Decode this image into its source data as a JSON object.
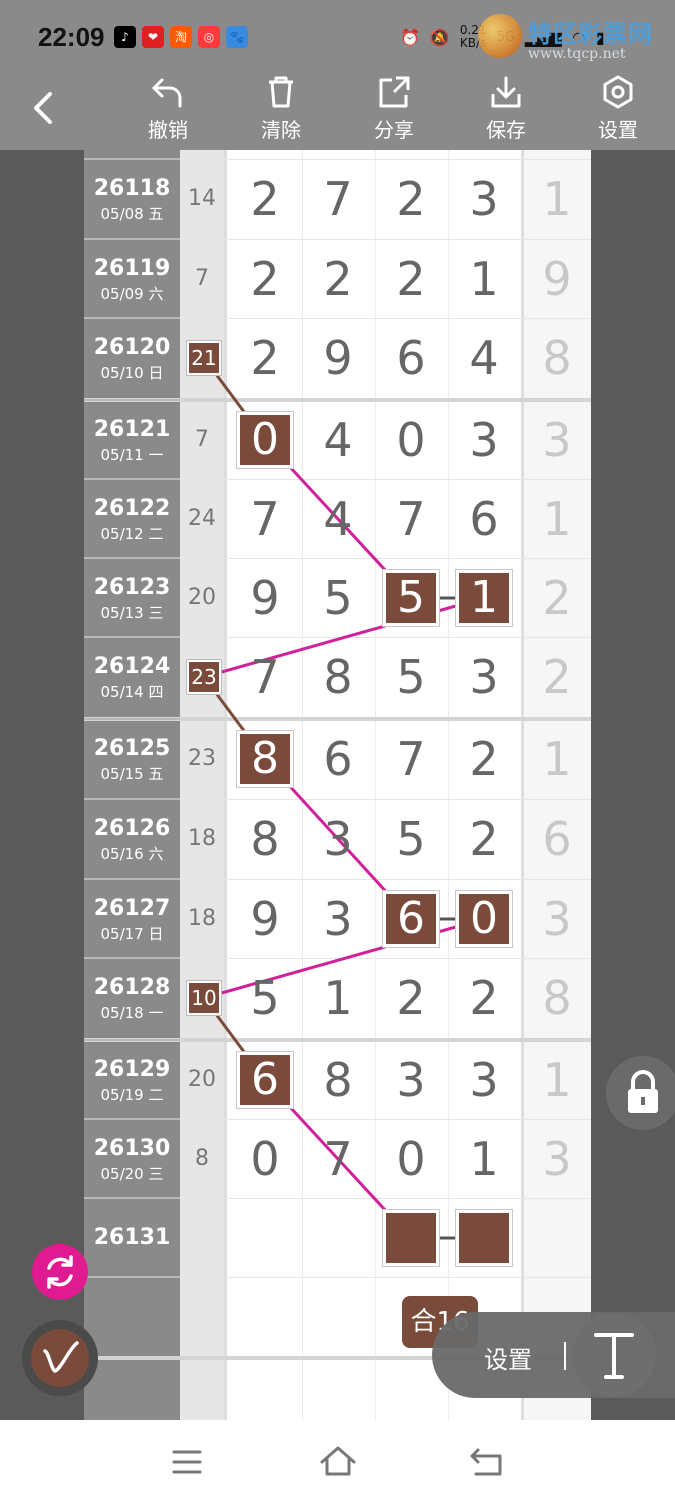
{
  "status": {
    "time": "22:09",
    "apps": [
      {
        "name": "tiktok-icon",
        "glyph": "♪",
        "color": "#000000"
      },
      {
        "name": "heart-app-icon",
        "glyph": "❤",
        "color": "#e02020"
      },
      {
        "name": "taobao-icon",
        "glyph": "淘",
        "color": "#ff5a00"
      },
      {
        "name": "app-icon",
        "glyph": "◎",
        "color": "#ff3a3a"
      },
      {
        "name": "paw-app-icon",
        "glyph": "🐾",
        "color": "#3a8ae0"
      }
    ],
    "net_speed": "0.21\nKB/s",
    "signal": "5G",
    "watermark_title": "特区彩票网",
    "watermark_url": "www.tqcp.net"
  },
  "toolbar": {
    "undo": "撤销",
    "clear": "清除",
    "share": "分享",
    "save": "保存",
    "settings": "设置"
  },
  "rows": [
    {
      "issue": "26118",
      "date": "05/08 五",
      "sum": "14",
      "digits": [
        "2",
        "7",
        "2",
        "3"
      ],
      "tail": "1"
    },
    {
      "issue": "26119",
      "date": "05/09 六",
      "sum": "7",
      "digits": [
        "2",
        "2",
        "2",
        "1"
      ],
      "tail": "9"
    },
    {
      "issue": "26120",
      "date": "05/10 日",
      "sum": "21",
      "digits": [
        "2",
        "9",
        "6",
        "4"
      ],
      "tail": "8"
    },
    {
      "issue": "26121",
      "date": "05/11 一",
      "sum": "7",
      "digits": [
        "0",
        "4",
        "0",
        "3"
      ],
      "tail": "3"
    },
    {
      "issue": "26122",
      "date": "05/12 二",
      "sum": "24",
      "digits": [
        "7",
        "4",
        "7",
        "6"
      ],
      "tail": "1"
    },
    {
      "issue": "26123",
      "date": "05/13 三",
      "sum": "20",
      "digits": [
        "9",
        "5",
        "5",
        "1"
      ],
      "tail": "2"
    },
    {
      "issue": "26124",
      "date": "05/14 四",
      "sum": "23",
      "digits": [
        "7",
        "8",
        "5",
        "3"
      ],
      "tail": "2"
    },
    {
      "issue": "26125",
      "date": "05/15 五",
      "sum": "23",
      "digits": [
        "8",
        "6",
        "7",
        "2"
      ],
      "tail": "1"
    },
    {
      "issue": "26126",
      "date": "05/16 六",
      "sum": "18",
      "digits": [
        "8",
        "3",
        "5",
        "2"
      ],
      "tail": "6"
    },
    {
      "issue": "26127",
      "date": "05/17 日",
      "sum": "18",
      "digits": [
        "9",
        "3",
        "6",
        "0"
      ],
      "tail": "3"
    },
    {
      "issue": "26128",
      "date": "05/18 一",
      "sum": "10",
      "digits": [
        "5",
        "1",
        "2",
        "2"
      ],
      "tail": "8"
    },
    {
      "issue": "26129",
      "date": "05/19 二",
      "sum": "20",
      "digits": [
        "6",
        "8",
        "3",
        "3"
      ],
      "tail": "1"
    },
    {
      "issue": "26130",
      "date": "05/20 三",
      "sum": "8",
      "digits": [
        "0",
        "7",
        "0",
        "1"
      ],
      "tail": "3"
    },
    {
      "issue": "26131",
      "date": "",
      "sum": "",
      "digits": [
        "",
        "",
        "",
        ""
      ],
      "tail": ""
    }
  ],
  "highlights": [
    {
      "row": 2,
      "col": "sum"
    },
    {
      "row": 3,
      "col": 0
    },
    {
      "row": 5,
      "col": 2
    },
    {
      "row": 5,
      "col": 3
    },
    {
      "row": 6,
      "col": "sum"
    },
    {
      "row": 7,
      "col": 0
    },
    {
      "row": 9,
      "col": 2
    },
    {
      "row": 9,
      "col": 3
    },
    {
      "row": 10,
      "col": "sum"
    },
    {
      "row": 11,
      "col": 0
    },
    {
      "row": 13,
      "col": 2
    },
    {
      "row": 13,
      "col": 3
    }
  ],
  "colors": {
    "highlight": "#7a4a3a",
    "line_pink": "#d0209a",
    "line_brown": "#7a4a3a",
    "panel": "#8a8a8a"
  },
  "bottom": {
    "badge": "合16",
    "settings_label": "设置"
  }
}
